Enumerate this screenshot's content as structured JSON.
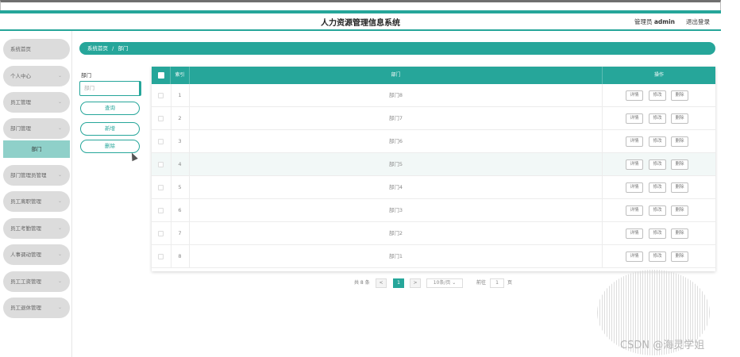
{
  "header": {
    "title": "人力资源管理信息系统",
    "admin_role": "管理员",
    "admin_name": "admin",
    "logout": "退出登录"
  },
  "sidebar": {
    "items": [
      {
        "label": "系统首页"
      },
      {
        "label": "个人中心"
      },
      {
        "label": "员工管理"
      },
      {
        "label": "部门管理"
      },
      {
        "label": "部门",
        "active": true
      },
      {
        "label": "部门管理员管理"
      },
      {
        "label": "员工离职管理"
      },
      {
        "label": "员工考勤管理"
      },
      {
        "label": "人事调动管理"
      },
      {
        "label": "员工工资管理"
      },
      {
        "label": "员工退休管理"
      }
    ],
    "chevron": "⌄"
  },
  "breadcrumb": {
    "home": "系统首页",
    "separator": "/",
    "current": "部门"
  },
  "filter": {
    "label": "部门",
    "placeholder": "部门",
    "query": "查询",
    "add": "新增",
    "delete": "删除"
  },
  "table": {
    "headers": {
      "index": "索引",
      "dept": "部门",
      "ops": "操作"
    },
    "rows": [
      {
        "index": "1",
        "dept": "部门8"
      },
      {
        "index": "2",
        "dept": "部门7"
      },
      {
        "index": "3",
        "dept": "部门6"
      },
      {
        "index": "4",
        "dept": "部门5"
      },
      {
        "index": "5",
        "dept": "部门4"
      },
      {
        "index": "6",
        "dept": "部门3"
      },
      {
        "index": "7",
        "dept": "部门2"
      },
      {
        "index": "8",
        "dept": "部门1"
      }
    ],
    "actions": {
      "detail": "详情",
      "edit": "修改",
      "delete": "删除"
    }
  },
  "pagination": {
    "total": "共 8 条",
    "prev": "<",
    "current_page": "1",
    "next": ">",
    "page_size": "10条/页",
    "goto_label": "前往",
    "goto_value": "1",
    "page_unit": "页"
  },
  "watermark": "CSDN @海灵学姐",
  "colors": {
    "accent": "#26a69a",
    "active_nav": "#8fd0c9"
  }
}
